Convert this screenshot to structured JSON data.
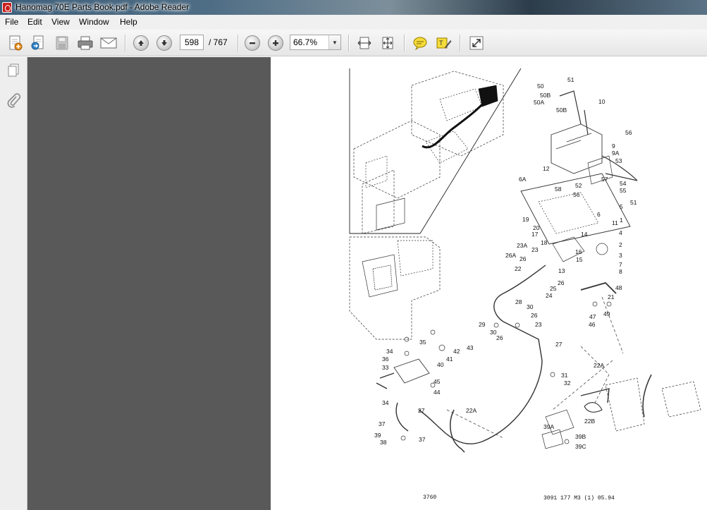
{
  "window": {
    "title": "Hanomag 70E Parts Book.pdf - Adobe Reader"
  },
  "menu": {
    "items": [
      "File",
      "Edit",
      "View",
      "Window",
      "Help"
    ]
  },
  "toolbar": {
    "page_current": "598",
    "page_total": "/ 767",
    "zoom": "66.7%"
  },
  "icons": {
    "create": "create-pdf-icon",
    "share": "share-icon",
    "save": "save-icon",
    "print": "print-icon",
    "email": "email-icon",
    "prev": "previous-page-icon",
    "next": "next-page-icon",
    "zoom_out": "zoom-out-icon",
    "zoom_in": "zoom-in-icon",
    "fit_width": "fit-width-icon",
    "fit_page": "fit-page-icon",
    "comment": "comment-icon",
    "highlight": "highlight-icon",
    "fullscreen": "expand-icon",
    "pages_panel": "pages-panel-icon",
    "attachments": "attachment-icon"
  },
  "document": {
    "part_labels": [
      "51",
      "50",
      "50B",
      "50A",
      "50B",
      "10",
      "56",
      "9",
      "9A",
      "53",
      "12",
      "6A",
      "57",
      "52",
      "54",
      "55",
      "58",
      "56",
      "51",
      "5",
      "6",
      "1",
      "11",
      "19",
      "20",
      "17",
      "14",
      "4",
      "18",
      "23A",
      "23",
      "16",
      "2",
      "26A",
      "26",
      "15",
      "3",
      "22",
      "13",
      "7",
      "8",
      "26",
      "25",
      "48",
      "24",
      "21",
      "28",
      "30",
      "26",
      "47",
      "49",
      "46",
      "29",
      "30",
      "23",
      "26",
      "35",
      "27",
      "34",
      "42",
      "43",
      "36",
      "41",
      "33",
      "40",
      "22A",
      "45",
      "31",
      "32",
      "44",
      "34",
      "27",
      "22A",
      "22B",
      "37",
      "39A",
      "39B",
      "39",
      "37",
      "39C",
      "38"
    ],
    "footer_left": "3760",
    "footer_right": "3091 177 M3 (1) 05.94"
  }
}
